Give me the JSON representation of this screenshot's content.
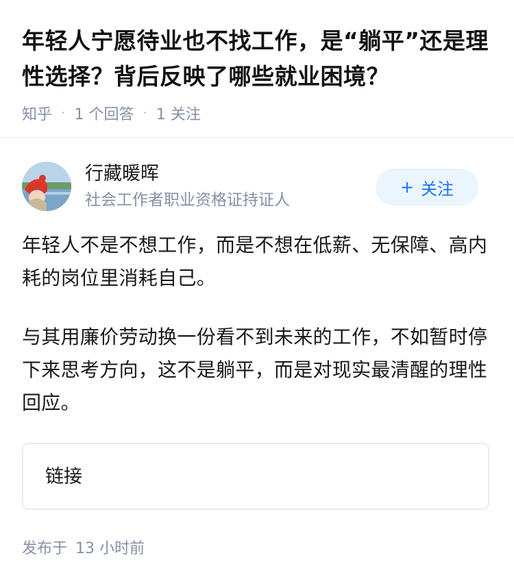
{
  "question": {
    "title": "年轻人宁愿待业也不找工作，是“躺平”还是理性选择？背后反映了哪些就业困境？",
    "source": "知乎",
    "separator": "·",
    "answer_count": "1 个回答",
    "follow_count": "1 关注"
  },
  "author": {
    "name": "行藏暖晖",
    "bio": "社会工作者职业资格证持证人",
    "follow_button": {
      "plus": "+",
      "label": "关注"
    }
  },
  "answer": {
    "paragraphs": [
      "年轻人不是不想工作，而是不想在低薪、无保障、高内耗的岗位里消耗自己。",
      "与其用廉价劳动换一份看不到未来的工作，不如暂时停下来思考方向，这不是躺平，而是对现实最清醒的理性回应。"
    ],
    "link_card_label": "链接"
  },
  "footer": {
    "published_prefix": "发布于",
    "published_time": "13 小时前"
  },
  "colors": {
    "accent": "#1772f6",
    "follow_bg": "#ebf5fd",
    "meta_gray": "#8590a6",
    "text": "#1a1a1a"
  },
  "icons": {
    "avatar": "avatar-photo-red-hat-by-lake"
  }
}
